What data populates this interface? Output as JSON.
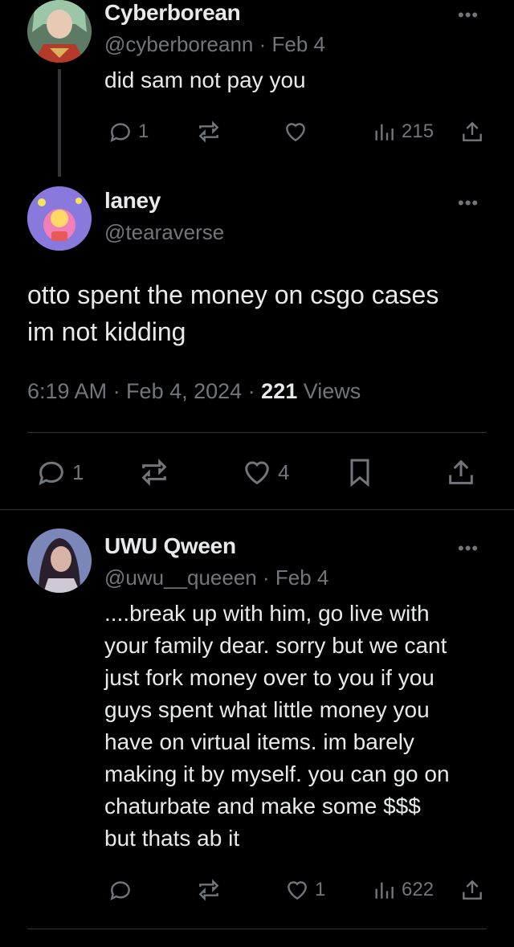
{
  "thread": [
    {
      "name": "Cyberborean",
      "handle": "@cyberboreann",
      "date": "· Feb 4",
      "text": "did sam not pay you",
      "replies": "1",
      "reposts": "",
      "likes": "",
      "views": "215",
      "avatar_icon": "anime-character-avatar"
    }
  ],
  "main": {
    "name": "laney",
    "handle": "@tearaverse",
    "text_line1": "otto spent the money on csgo cases",
    "text_line2": "im not kidding",
    "time": "6:19 AM · Feb 4, 2024 · ",
    "views_count": "221",
    "views_label": " Views",
    "replies": "1",
    "likes": "4",
    "avatar_icon": "cartoon-avatar"
  },
  "reply": {
    "name": "UWU Qween",
    "handle": "@uwu__queeen",
    "date": "· Feb 4",
    "lines": [
      "....break up with him, go live with",
      "your family dear. sorry but we cant",
      "just fork money over to you if you",
      "guys spent what little money you",
      "have on virtual items. im barely",
      "making it by myself. you can go on",
      "chaturbate and make some $$$",
      "but thats ab it"
    ],
    "likes": "1",
    "views": "622",
    "avatar_icon": "person-photo-avatar"
  },
  "more_label": "•••",
  "colors": {
    "bg": "#000000",
    "text": "#e7e9ea",
    "muted": "#71767b",
    "divider": "#2f3336"
  }
}
